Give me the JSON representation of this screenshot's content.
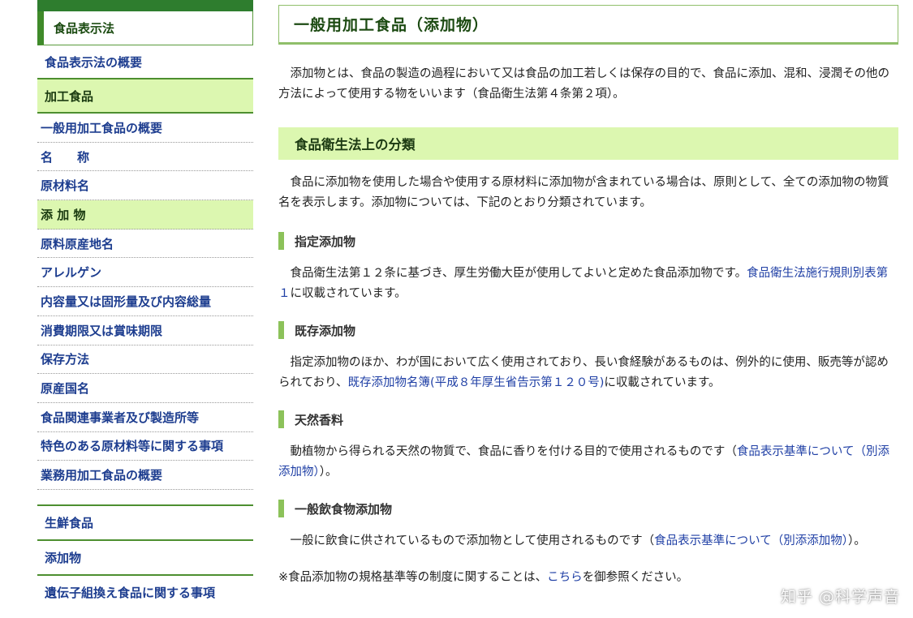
{
  "sidebar": {
    "header": "食品表示法",
    "overview": "食品表示法の概要",
    "processed": "加工食品",
    "items": [
      "一般用加工食品の概要",
      "名　　称",
      "原材料名",
      "添 加 物",
      "原料原産地名",
      "アレルゲン",
      "内容量又は固形量及び内容総量",
      "消費期限又は賞味期限",
      "保存方法",
      "原産国名",
      "食品関連事業者及び製造所等",
      "特色のある原材料等に関する事項",
      "業務用加工食品の概要"
    ],
    "sections": [
      "生鮮食品",
      "添加物",
      "遺伝子組換え食品に関する事項"
    ]
  },
  "main": {
    "title": "一般用加工食品（添加物）",
    "intro": "添加物とは、食品の製造の過程において又は食品の加工若しくは保存の目的で、食品に添加、混和、浸潤その他の方法によって使用する物をいいます（食品衛生法第４条第２項）。",
    "section_title": "食品衛生法上の分類",
    "section_text": "食品に添加物を使用した場合や使用する原材料に添加物が含まれている場合は、原則として、全ての添加物の物質名を表示します。添加物については、下記のとおり分類されています。",
    "designated": {
      "heading": "指定添加物",
      "text1": "食品衛生法第１２条に基づき、厚生労働大臣が使用してよいと定めた食品添加物です。",
      "link": "食品衛生法施行規則別表第１",
      "text2": "に収載されています。"
    },
    "existing": {
      "heading": "既存添加物",
      "text1": "指定添加物のほか、わが国において広く使用されており、長い食経験があるものは、例外的に使用、販売等が認められており、",
      "link": "既存添加物名簿(平成８年厚生省告示第１２０号)",
      "text2": "に収載されています。"
    },
    "flavor": {
      "heading": "天然香料",
      "text1": "動植物から得られる天然の物質で、食品に香りを付ける目的で使用されるものです（",
      "link": "食品表示基準について（別添 添加物）",
      "text2": "）。"
    },
    "general": {
      "heading": "一般飲食物添加物",
      "text1": "一般に飲食に供されているもので添加物として使用されるものです（",
      "link": "食品表示基準について（別添添加物）",
      "text2": "）。"
    },
    "note": {
      "text1": "※食品添加物の規格基準等の制度に関することは、",
      "link": "こちら",
      "text2": "を御参照ください。"
    }
  },
  "watermark": "知乎 @科学声音",
  "colors": {
    "accent_green": "#8cc25a",
    "highlight": "#dcf7b0",
    "link": "#1f3fa5",
    "dark_green": "#2e7d2e"
  }
}
